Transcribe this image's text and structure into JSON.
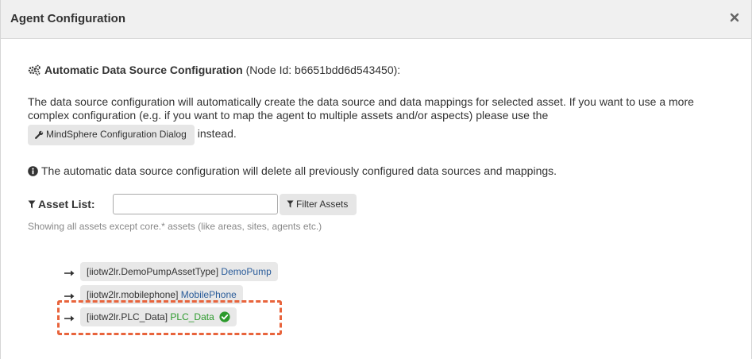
{
  "dialog": {
    "title": "Agent Configuration"
  },
  "heading": {
    "title": "Automatic Data Source Configuration",
    "node_id": "(Node Id: b6651bdd6d543450):"
  },
  "description": {
    "text": "The data source configuration will automatically create the data source and data mappings for selected asset. If you want to use a more complex configuration (e.g. if you want to map the agent to multiple assets and/or aspects) please use the",
    "button_label": "MindSphere Configuration Dialog",
    "suffix": "instead."
  },
  "warning": {
    "text": "The automatic data source configuration will delete all previously configured data sources and mappings."
  },
  "asset_filter": {
    "label": "Asset List:",
    "input_value": "",
    "button_label": "Filter Assets",
    "hint": "Showing all assets except core.* assets (like areas, sites, agents etc.)"
  },
  "assets": [
    {
      "type": "[iiotw2lr.DemoPumpAssetType]",
      "name": "DemoPump",
      "selected": false
    },
    {
      "type": "[iiotw2lr.mobilephone]",
      "name": "MobilePhone",
      "selected": false
    },
    {
      "type": "[iiotw2lr.PLC_Data]",
      "name": "PLC_Data",
      "selected": true
    }
  ],
  "colors": {
    "title_bar": "#f0f0f0",
    "asset_name": "#2a5c9a",
    "selected_asset_name": "#2c9a2c",
    "highlight_border": "#e8643c"
  },
  "icons": {
    "heading": "gears-icon",
    "close": "close-icon",
    "button": "wrench-icon",
    "warning": "info-circle-icon",
    "filter": "filter-icon",
    "tree_node": "arrow-right-icon",
    "selected": "check-circle-icon"
  }
}
